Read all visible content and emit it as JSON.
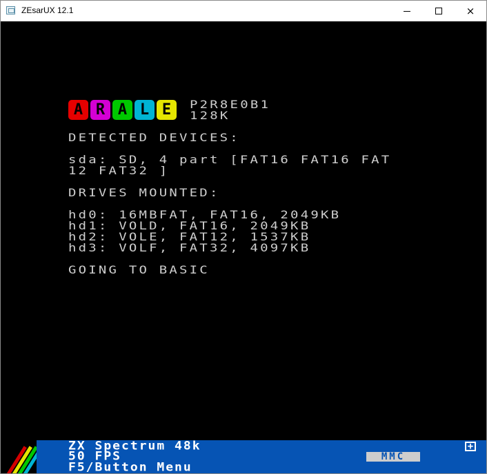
{
  "window": {
    "title": "ZEsarUX 12.1",
    "icon": "zesarux-app-icon",
    "controls": {
      "minimize": "minimize-icon",
      "maximize": "maximize-icon",
      "close": "×"
    }
  },
  "screen": {
    "logo_letters": [
      {
        "char": "A",
        "color": "#e60000"
      },
      {
        "char": "R",
        "color": "#d400d4"
      },
      {
        "char": "A",
        "color": "#00c800"
      },
      {
        "char": "L",
        "color": "#00b4d4"
      },
      {
        "char": "E",
        "color": "#e6e600"
      }
    ],
    "firmware": "P2R8E0B1",
    "memory": "128K",
    "detected_heading": "DETECTED DEVICES:",
    "device_line_1": "sda: SD, 4 part [FAT16 FAT16 FAT",
    "device_line_2": "12 FAT32 ]",
    "mounted_heading": "DRIVES MOUNTED:",
    "drives": [
      "hd0: 16MBFAT, FAT16, 2049KB",
      "hd1: VOLD, FAT16, 2049KB",
      "hd2: VOLE, FAT12, 1537KB",
      "hd3: VOLF, FAT32, 4097KB"
    ],
    "final_message": "GOING TO BASIC"
  },
  "statusbar": {
    "machine": "ZX Spectrum 48k",
    "fps": "50 FPS",
    "menu_hint": "F5/Button Menu",
    "mmc_label": "MMC",
    "plus_label": "+",
    "colors": {
      "background": "#0654b4",
      "text": "#ffffff"
    }
  }
}
